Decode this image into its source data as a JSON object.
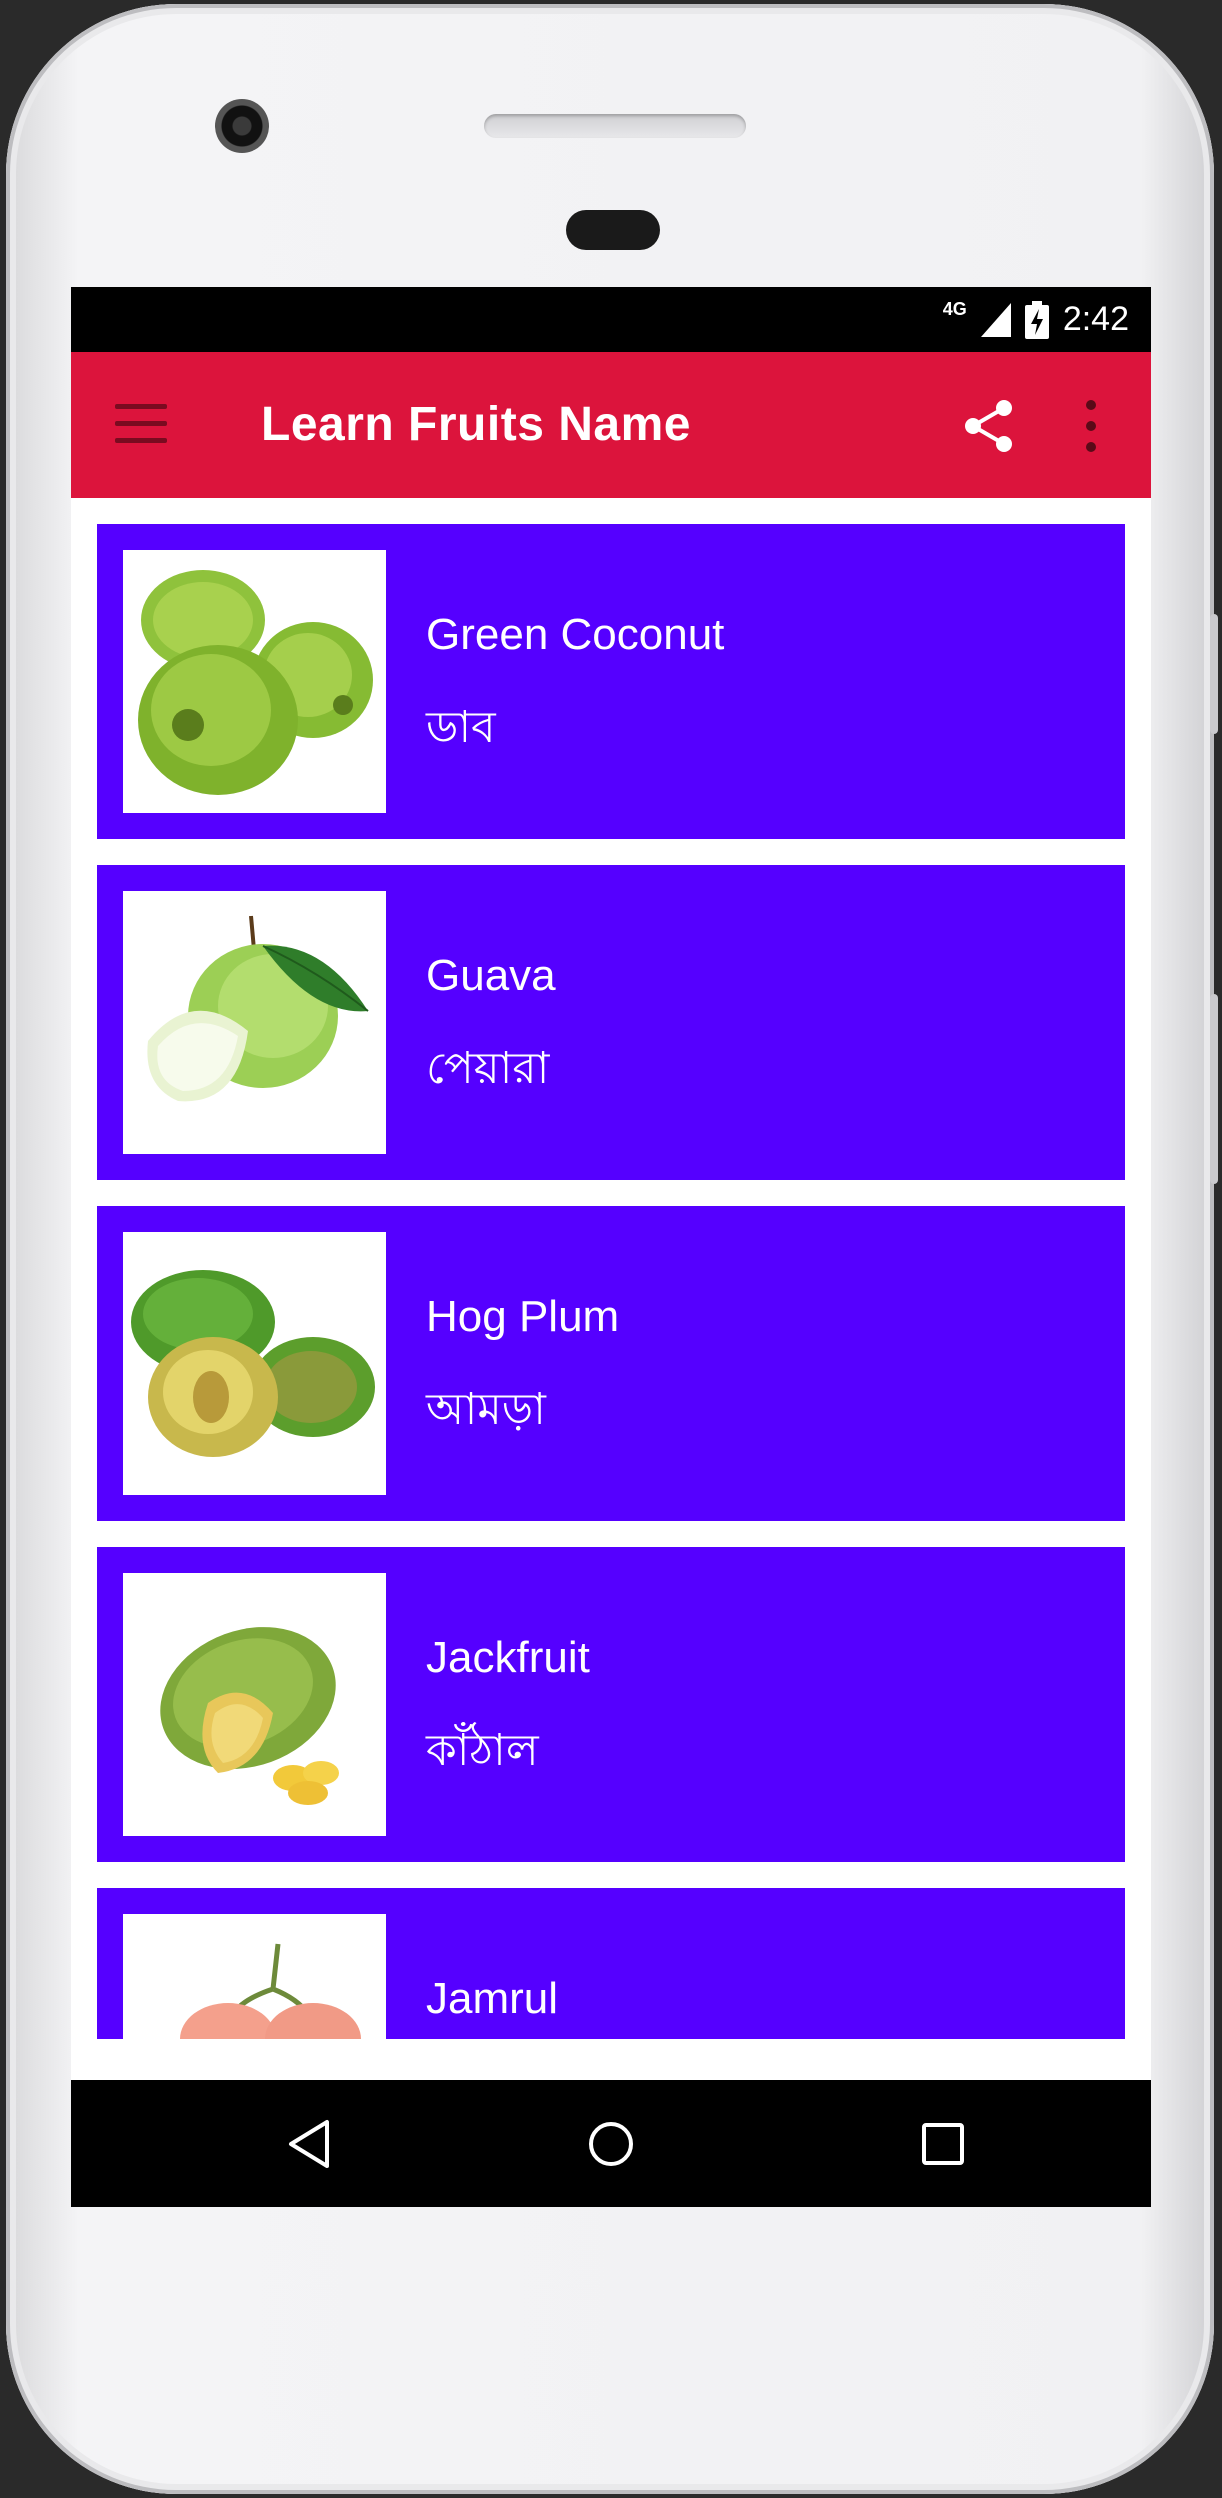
{
  "status_bar": {
    "network": "4G",
    "time": "2:42"
  },
  "app_bar": {
    "title": "Learn Fruits Name",
    "icons": [
      "menu-icon",
      "share-icon",
      "more-vert-icon"
    ],
    "color": "#dc143c"
  },
  "fruits": [
    {
      "english": "Green Coconut",
      "bengali": "ডাব",
      "image": "green-coconut-image"
    },
    {
      "english": "Guava",
      "bengali": "পেয়ারা",
      "image": "guava-image"
    },
    {
      "english": "Hog Plum",
      "bengali": "আমড়া",
      "image": "hog-plum-image"
    },
    {
      "english": "Jackfruit",
      "bengali": "কাঁঠাল",
      "image": "jackfruit-image"
    },
    {
      "english": "Jamrul",
      "bengali": "",
      "image": "jamrul-image"
    }
  ],
  "colors": {
    "card": "#5500ff",
    "text": "#ffffff"
  },
  "nav_bar": {
    "icons": [
      "back-icon",
      "home-icon",
      "recents-icon"
    ]
  }
}
